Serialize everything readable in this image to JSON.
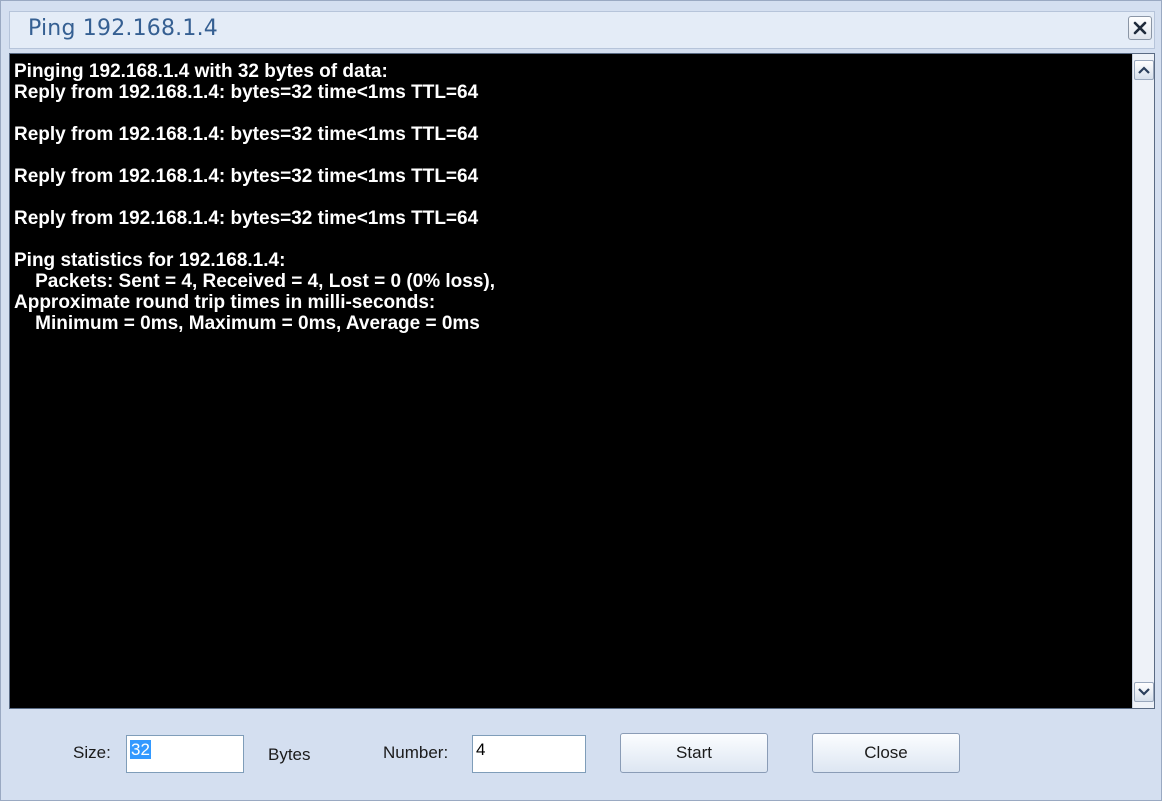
{
  "window": {
    "title": "Ping 192.168.1.4"
  },
  "console": {
    "lines": [
      "Pinging 192.168.1.4 with 32 bytes of data:",
      "Reply from 192.168.1.4: bytes=32 time<1ms TTL=64",
      "",
      "Reply from 192.168.1.4: bytes=32 time<1ms TTL=64",
      "",
      "Reply from 192.168.1.4: bytes=32 time<1ms TTL=64",
      "",
      "Reply from 192.168.1.4: bytes=32 time<1ms TTL=64",
      "",
      "Ping statistics for 192.168.1.4:",
      "    Packets: Sent = 4, Received = 4, Lost = 0 (0% loss),",
      "Approximate round trip times in milli-seconds:",
      "    Minimum = 0ms, Maximum = 0ms, Average = 0ms"
    ],
    "background_color": "#000000",
    "text_color": "#ffffff"
  },
  "controls": {
    "size_label": "Size:",
    "size_value": "32",
    "bytes_label": "Bytes",
    "number_label": "Number:",
    "number_value": "4",
    "start_label": "Start",
    "close_label": "Close"
  },
  "icons": {
    "close": "close-icon",
    "scroll_up": "chevron-up-icon",
    "scroll_down": "chevron-down-icon"
  }
}
